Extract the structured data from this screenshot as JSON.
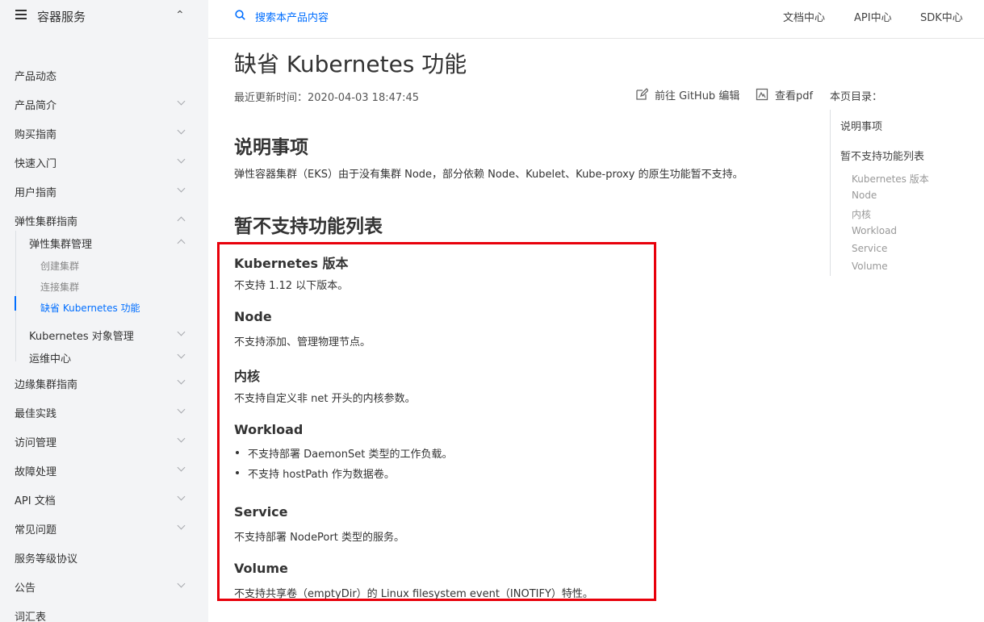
{
  "sidebar": {
    "title": "容器服务",
    "items": [
      {
        "label": "产品动态"
      },
      {
        "label": "产品简介"
      },
      {
        "label": "购买指南"
      },
      {
        "label": "快速入门"
      },
      {
        "label": "用户指南"
      },
      {
        "label": "弹性集群指南"
      },
      {
        "label": "弹性集群管理"
      },
      {
        "label": "创建集群"
      },
      {
        "label": "连接集群"
      },
      {
        "label": "缺省 Kubernetes 功能"
      },
      {
        "label": "Kubernetes 对象管理"
      },
      {
        "label": "运维中心"
      },
      {
        "label": "边缘集群指南"
      },
      {
        "label": "最佳实践"
      },
      {
        "label": "访问管理"
      },
      {
        "label": "故障处理"
      },
      {
        "label": "API 文档"
      },
      {
        "label": "常见问题"
      },
      {
        "label": "服务等级协议"
      },
      {
        "label": "公告"
      },
      {
        "label": "词汇表"
      }
    ]
  },
  "topnav": {
    "search_placeholder": "搜索本产品内容",
    "links": [
      "文档中心",
      "API中心",
      "SDK中心"
    ]
  },
  "page": {
    "title": "缺省 Kubernetes 功能",
    "updated": "最近更新时间：2020-04-03 18:47:45",
    "github_label": "前往 GitHub 编辑",
    "pdf_label": "查看pdf",
    "toc_title": "本页目录："
  },
  "content": {
    "notes_heading": "说明事项",
    "notes_text": "弹性容器集群（EKS）由于没有集群 Node，部分依赖 Node、Kubelet、Kube-proxy 的原生功能暂不支持。",
    "list_heading": "暂不支持功能列表",
    "sections": [
      {
        "heading": "Kubernetes 版本",
        "text": "不支持 1.12 以下版本。"
      },
      {
        "heading": "Node",
        "text": "不支持添加、管理物理节点。"
      },
      {
        "heading": "内核",
        "text": "不支持自定义非 net 开头的内核参数。"
      },
      {
        "heading": "Workload",
        "bullets": [
          "不支持部署 DaemonSet 类型的工作负载。",
          "不支持 hostPath 作为数据卷。"
        ]
      },
      {
        "heading": "Service",
        "text": "不支持部署 NodePort 类型的服务。"
      },
      {
        "heading": "Volume",
        "text": "不支持共享卷（emptyDir）的 Linux filesystem event（INOTIFY）特性。"
      }
    ]
  },
  "toc": {
    "items": [
      "说明事项",
      "暂不支持功能列表"
    ],
    "subitems": [
      "Kubernetes 版本",
      "Node",
      "内核",
      "Workload",
      "Service",
      "Volume"
    ]
  },
  "colors": {
    "accent": "#006eff",
    "highlight": "#e8000b",
    "sidebar_bg": "#f3f4f6"
  }
}
